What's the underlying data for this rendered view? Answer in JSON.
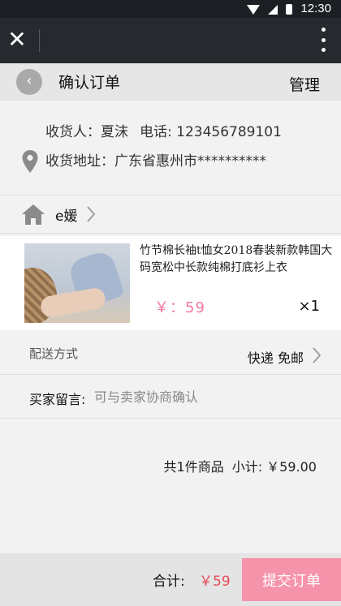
{
  "status_bar": {
    "time": "12:30",
    "icons": [
      "wifi-icon",
      "signal-icon",
      "battery-icon"
    ]
  },
  "app_bar": {
    "close_icon": "close-icon",
    "more_icon": "more-vertical-icon"
  },
  "header": {
    "back_icon": "chevron-left-icon",
    "title": "确认订单",
    "manage_label": "管理"
  },
  "address": {
    "recipient_label": "收货人：",
    "recipient_name": "夏沫",
    "phone_label": "电话:",
    "phone": "123456789101",
    "address_label": "收货地址：",
    "address_value": "广东省惠州市**********"
  },
  "shop": {
    "name": "e媛"
  },
  "product": {
    "title": "竹节棉长袖t恤女2018春装新款韩国大码宽松中长款纯棉打底衫上衣",
    "price": "￥：59",
    "quantity": "×1"
  },
  "delivery": {
    "label": "配送方式",
    "value": "快递 免邮"
  },
  "message": {
    "label": "买家留言:",
    "placeholder": "可与卖家协商确认"
  },
  "summary": {
    "count_text": "共1件商品",
    "subtotal_text": "小计: ￥59.00"
  },
  "footer": {
    "total_label": "合计:",
    "total_value": "￥59",
    "submit_label": "提交订单"
  },
  "colors": {
    "accent_pink": "#f593ab",
    "price_pink": "#f07aa0",
    "total_red": "#e84c5a",
    "appbar": "#26292e"
  }
}
